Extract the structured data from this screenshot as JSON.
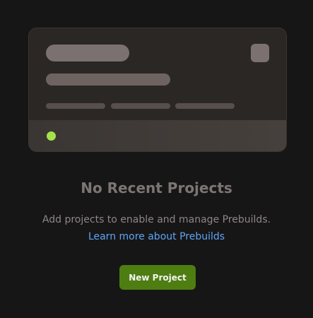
{
  "empty_state": {
    "heading": "No Recent Projects",
    "description": "Add projects to enable and manage Prebuilds.",
    "link_text": "Learn more about Prebuilds",
    "button_label": "New Project"
  },
  "colors": {
    "background": "#161616",
    "accent_button": "#4e7d12",
    "link": "#5fa4f3",
    "status_dot": "#a2e34a"
  }
}
